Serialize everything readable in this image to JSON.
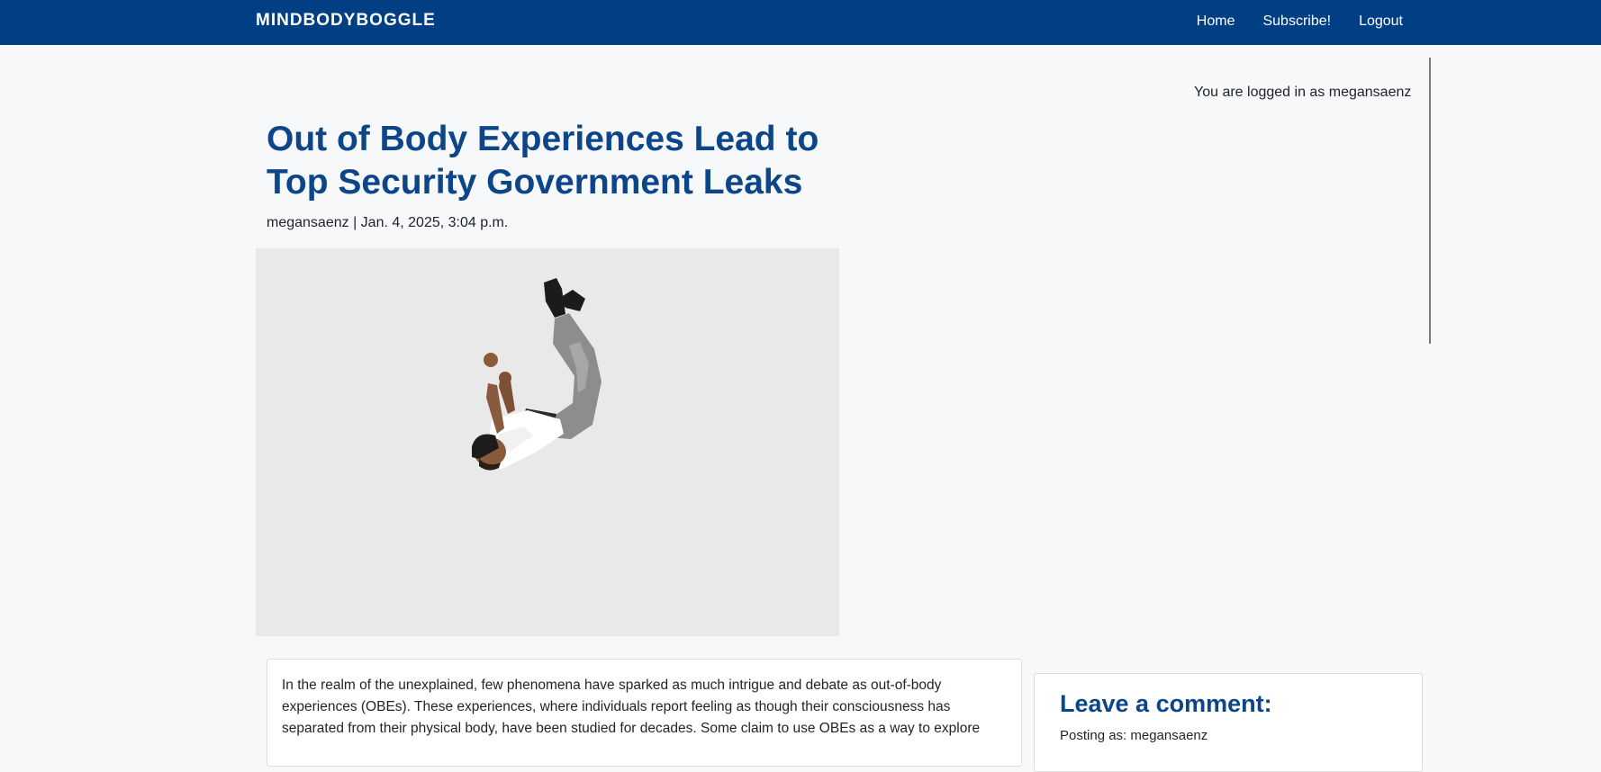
{
  "navbar": {
    "brand": "MINDBODYBOGGLE",
    "links": [
      "Home",
      "Subscribe!",
      "Logout"
    ],
    "background_color": "#013f84"
  },
  "session": {
    "logged_in_text": "You are logged in as megansaenz"
  },
  "post": {
    "title": "Out of Body Experiences Lead to Top Security Government Leaks",
    "meta": "megansaenz | Jan. 4, 2025, 3:04 p.m.",
    "image_alt": "Man falling upside down against a light grey background",
    "body_text": "In the realm of the unexplained, few phenomena have sparked as much intrigue and debate as out-of-body experiences (OBEs). These experiences, where individuals report feeling as though their consciousness has separated from their physical body, have been studied for decades. Some claim to use OBEs as a way to explore"
  },
  "comment_form": {
    "heading": "Leave a comment:",
    "posting_as": "Posting as: megansaenz"
  },
  "colors": {
    "accent": "#0c4588",
    "page_background": "#f7f8fa"
  }
}
